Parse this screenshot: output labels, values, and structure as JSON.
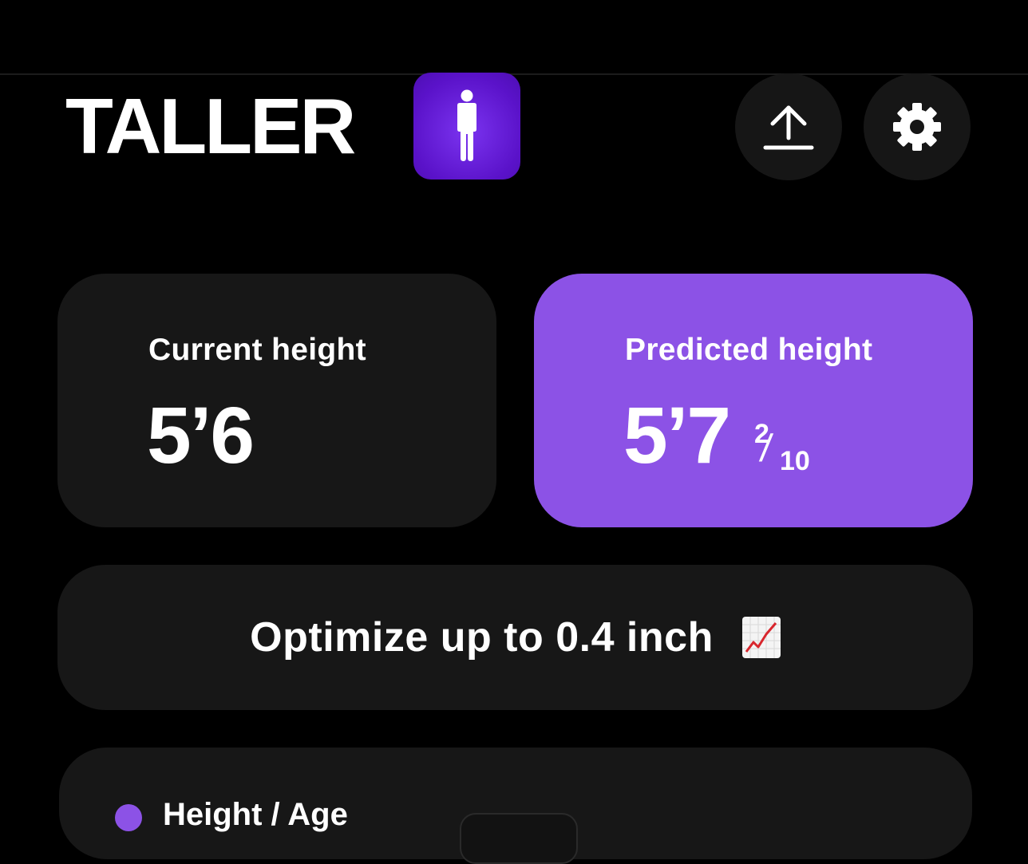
{
  "app": {
    "title": "TALLER",
    "badge_icon": "person-standing-icon"
  },
  "header": {
    "upload_icon": "upload-icon",
    "settings_icon": "gear-icon"
  },
  "current": {
    "label": "Current height",
    "value": "5’6"
  },
  "predicted": {
    "label": "Predicted height",
    "value": "5’7",
    "fraction_numerator": "2",
    "fraction_denominator": "10"
  },
  "optimize": {
    "text": "Optimize up to 0.4 inch",
    "icon": "chart-increasing-icon"
  },
  "chart": {
    "legend_label": "Height / Age",
    "legend_color": "#8c52e6"
  },
  "colors": {
    "accent": "#8c52e6",
    "badge": "#5a12c9",
    "card_bg": "#171717",
    "background": "#000000"
  }
}
